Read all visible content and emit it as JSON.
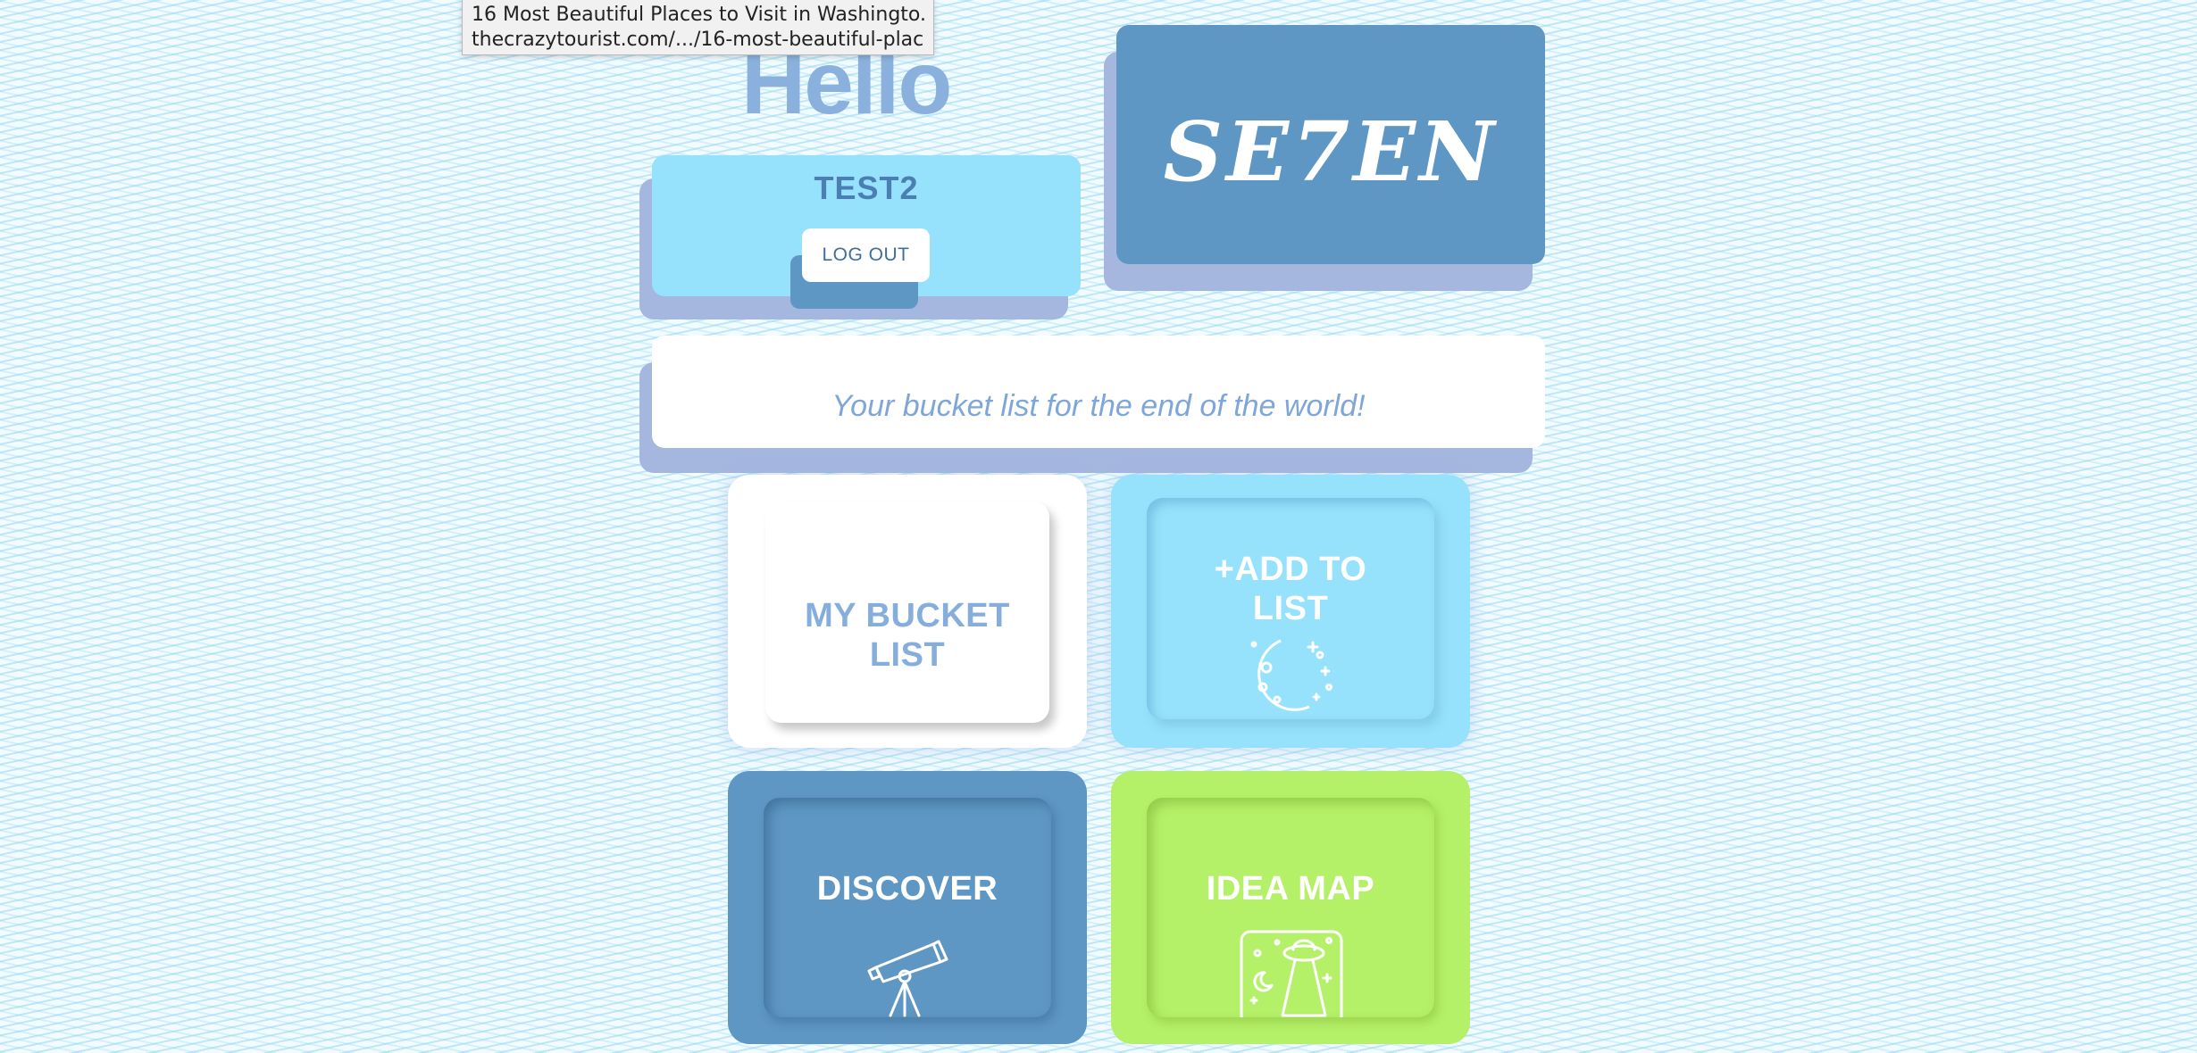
{
  "tooltip": {
    "title": "16 Most Beautiful Places to Visit in Washingto...",
    "url": "thecrazytourist.com/.../16-most-beautiful-plac..."
  },
  "greeting": "Hello",
  "user": {
    "name": "TEST2",
    "logout_label": "LOG OUT"
  },
  "logo": {
    "text": "SE7EN"
  },
  "tagline": "Your bucket list for the end of the world!",
  "tiles": {
    "bucket": {
      "label_line1": "MY BUCKET",
      "label_line2": "LIST"
    },
    "add": {
      "label_line1": "+ADD TO",
      "label_line2": "LIST",
      "icon": "moon-stars-icon"
    },
    "discover": {
      "label": "DISCOVER",
      "icon": "telescope-icon"
    },
    "ideamap": {
      "label": "IDEA MAP",
      "icon": "ufo-map-icon"
    }
  },
  "colors": {
    "light_blue": "#96e1fb",
    "steel_blue": "#5e97c3",
    "lime": "#b4f068",
    "shadow_lavender": "#a6b7df",
    "heading_blue": "#8ab1de"
  }
}
